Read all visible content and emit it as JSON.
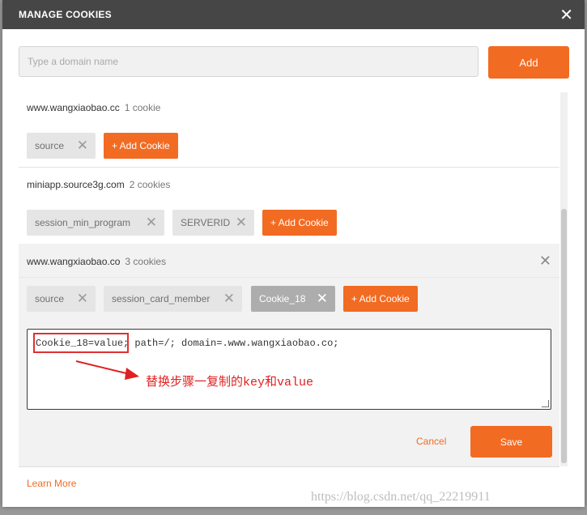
{
  "dialog": {
    "title": "MANAGE COOKIES",
    "close_icon": "close-icon"
  },
  "search": {
    "placeholder": "Type a domain name",
    "value": "",
    "add_label": "Add"
  },
  "domains": [
    {
      "name": "www.wangxiaobao.cc",
      "count": "1 cookie",
      "cookies": [
        {
          "name": "source",
          "active": false
        }
      ],
      "add_label": "+ Add Cookie"
    },
    {
      "name": "miniapp.source3g.com",
      "count": "2 cookies",
      "cookies": [
        {
          "name": "session_min_program",
          "active": false
        },
        {
          "name": "SERVERID",
          "active": false
        }
      ],
      "add_label": "+ Add Cookie"
    },
    {
      "name": "www.wangxiaobao.co",
      "count": "3 cookies",
      "cookies": [
        {
          "name": "source",
          "active": false
        },
        {
          "name": "session_card_member",
          "active": false
        },
        {
          "name": "Cookie_18",
          "active": true
        }
      ],
      "add_label": "+ Add Cookie",
      "editor": {
        "highlighted": "Cookie_18=value",
        "rest": "; path=/; domain=.www.wangxiaobao.co;"
      },
      "annotation": "替换步骤一复制的key和value",
      "cancel_label": "Cancel",
      "save_label": "Save"
    }
  ],
  "footer": {
    "learn_more": "Learn More"
  },
  "watermark": "https://blog.csdn.net/qq_22219911",
  "colors": {
    "accent": "#f26b22",
    "titlebar": "#464646",
    "annotation_red": "#e02020"
  }
}
